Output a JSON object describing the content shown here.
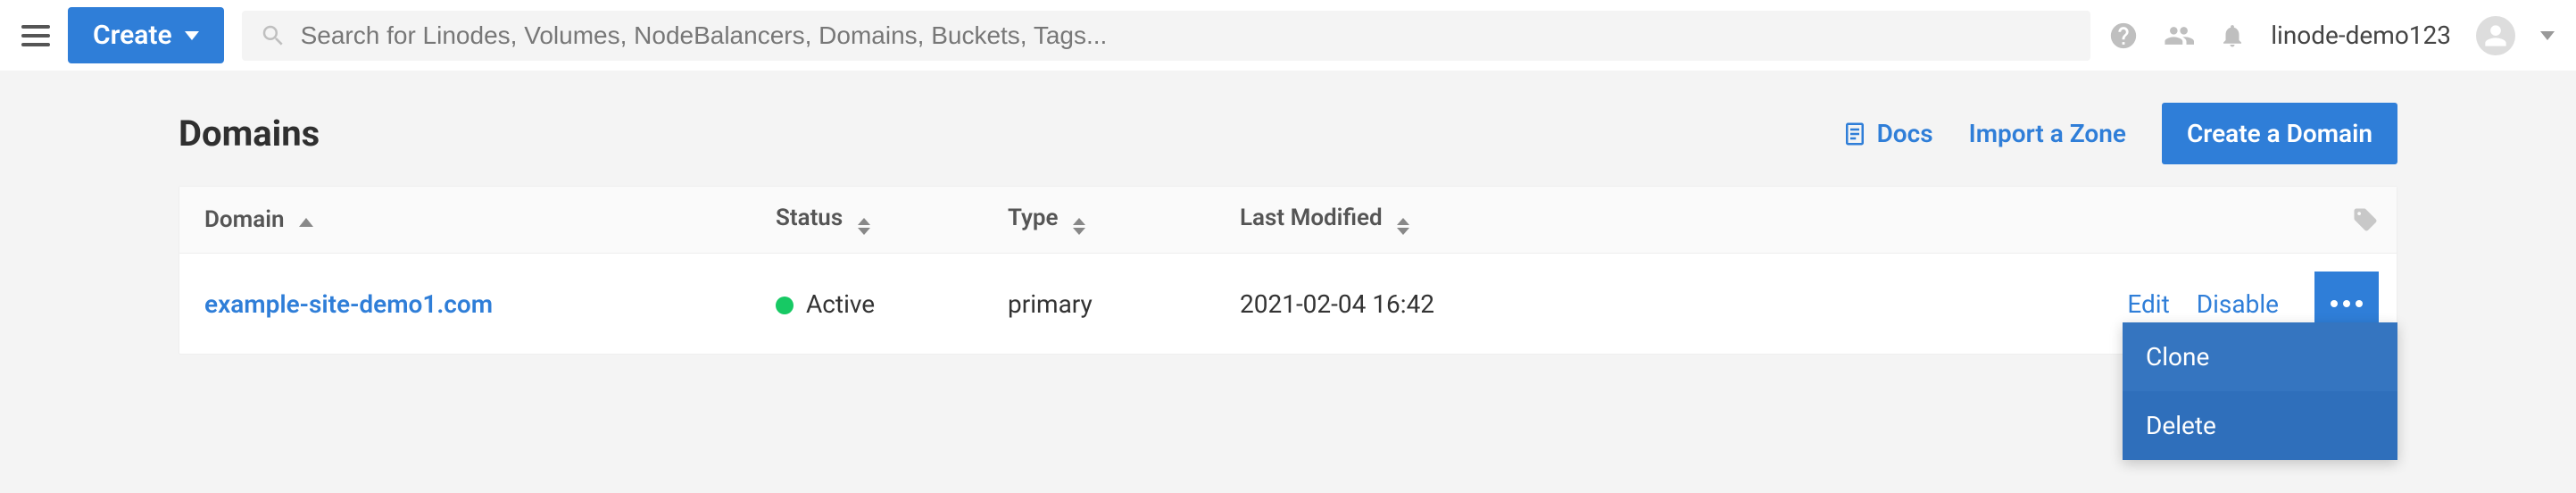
{
  "topbar": {
    "create_label": "Create",
    "search_placeholder": "Search for Linodes, Volumes, NodeBalancers, Domains, Buckets, Tags...",
    "username": "linode-demo123"
  },
  "page": {
    "title": "Domains",
    "docs_label": "Docs",
    "import_label": "Import a Zone",
    "create_domain_label": "Create a Domain"
  },
  "table": {
    "headers": {
      "domain": "Domain",
      "status": "Status",
      "type": "Type",
      "last_modified": "Last Modified"
    },
    "rows": [
      {
        "domain": "example-site-demo1.com",
        "status": "Active",
        "status_color": "#17c964",
        "type": "primary",
        "last_modified": "2021-02-04 16:42",
        "actions": {
          "edit": "Edit",
          "disable": "Disable"
        }
      }
    ]
  },
  "row_menu": {
    "items": [
      {
        "label": "Clone"
      },
      {
        "label": "Delete"
      }
    ]
  }
}
